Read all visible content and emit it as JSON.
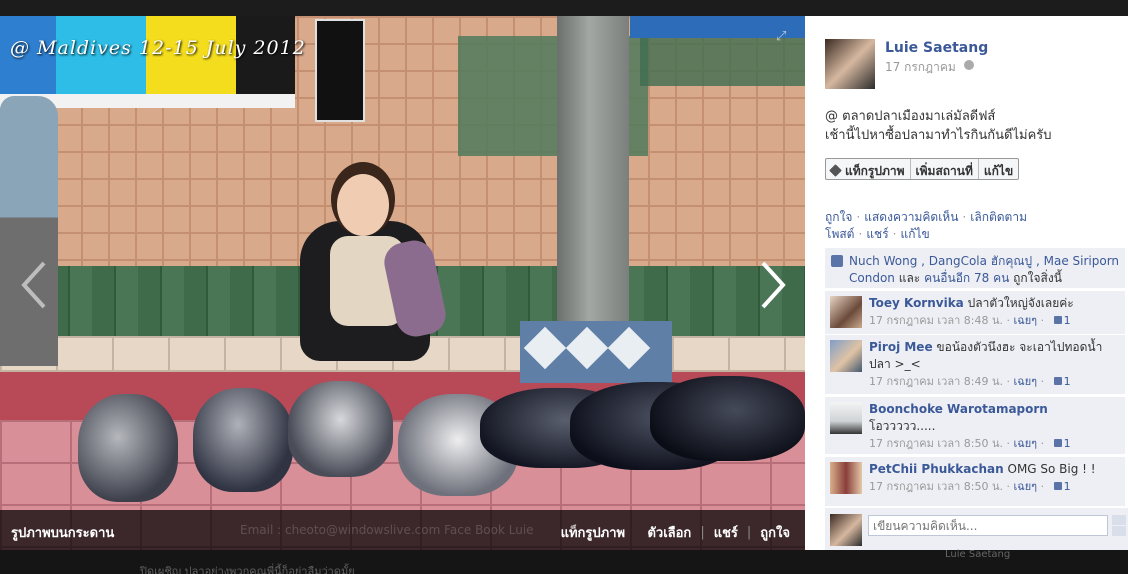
{
  "photo": {
    "caption": "@ Maldives  12-15 July 2012",
    "album_name": "รูปภาพบนกระดาน",
    "watermark": "Email : cheoto@windowslive.com  Face Book  Luie",
    "actions": [
      "แท็กรูปภาพ",
      "ตัวเลือก",
      "แชร์",
      "ถูกใจ"
    ]
  },
  "post": {
    "owner_name": "Luie Saetang",
    "date": "17 กรกฎาคม",
    "text_lines": [
      "@ ตลาดปลาเมืองมาเล่มัลดีฟส์",
      "เช้านี้ไปหาซื้อปลามาทำไรกินกันดีไม่ครับ"
    ],
    "toolbar": [
      "แท็กรูปภาพ",
      "เพิ่มสถานที่",
      "แก้ไข"
    ],
    "action_links": [
      "ถูกใจ",
      "แสดงความคิดเห็น",
      "เลิกติดตามโพสต์",
      "แชร์",
      "แก้ไข"
    ]
  },
  "likes": {
    "names": "Nuch Wong , DangCola ฮักคุณปู , Mae Siriporn Condon",
    "and_word": " และ ",
    "others": "คนอื่นอีก 78 คน",
    "suffix": " ถูกใจสิ่งนี้"
  },
  "comments": [
    {
      "name": "Toey Kornvika",
      "text": "ปลาตัวใหญ่จังเลยค่ะ",
      "time": "17 กรกฎาคม เวลา 8:48 น.",
      "reply": "เฉยๆ",
      "likes": "1"
    },
    {
      "name": "Piroj Mee",
      "text": "ขอน้องตัวนึงฮะ จะเอาไปทอดน้ำปลา >_<",
      "time": "17 กรกฎาคม เวลา 8:49 น.",
      "reply": "เฉยๆ",
      "likes": "1"
    },
    {
      "name": "Boonchoke Warotamaporn",
      "text": "โอววววว.....",
      "time": "17 กรกฎาคม เวลา 8:50 น.",
      "reply": "เฉยๆ",
      "likes": "1"
    },
    {
      "name": "PetChii Phukkachan",
      "text": "OMG So Big ! !",
      "time": "17 กรกฎาคม เวลา 8:50 น.",
      "reply": "เฉยๆ",
      "likes": "1"
    }
  ],
  "compose": {
    "placeholder": "เขียนความคิดเห็น..."
  },
  "behind": {
    "bottom_text": "ปิดเผชิญ ปลาอย่างพวกคุณพี่นี้ก็อย่าลืมว่าดูมั้ย",
    "right_text": "Luie Saetang"
  },
  "colors": {
    "link": "#3b5998",
    "comment_bg": "#edeff4",
    "overlay": "#000000"
  },
  "icons": {
    "prev": "chevron-left-icon",
    "next": "chevron-right-icon",
    "expand": "expand-icon",
    "tag": "tag-icon",
    "like": "thumbs-up-icon",
    "privacy": "globe-icon"
  }
}
